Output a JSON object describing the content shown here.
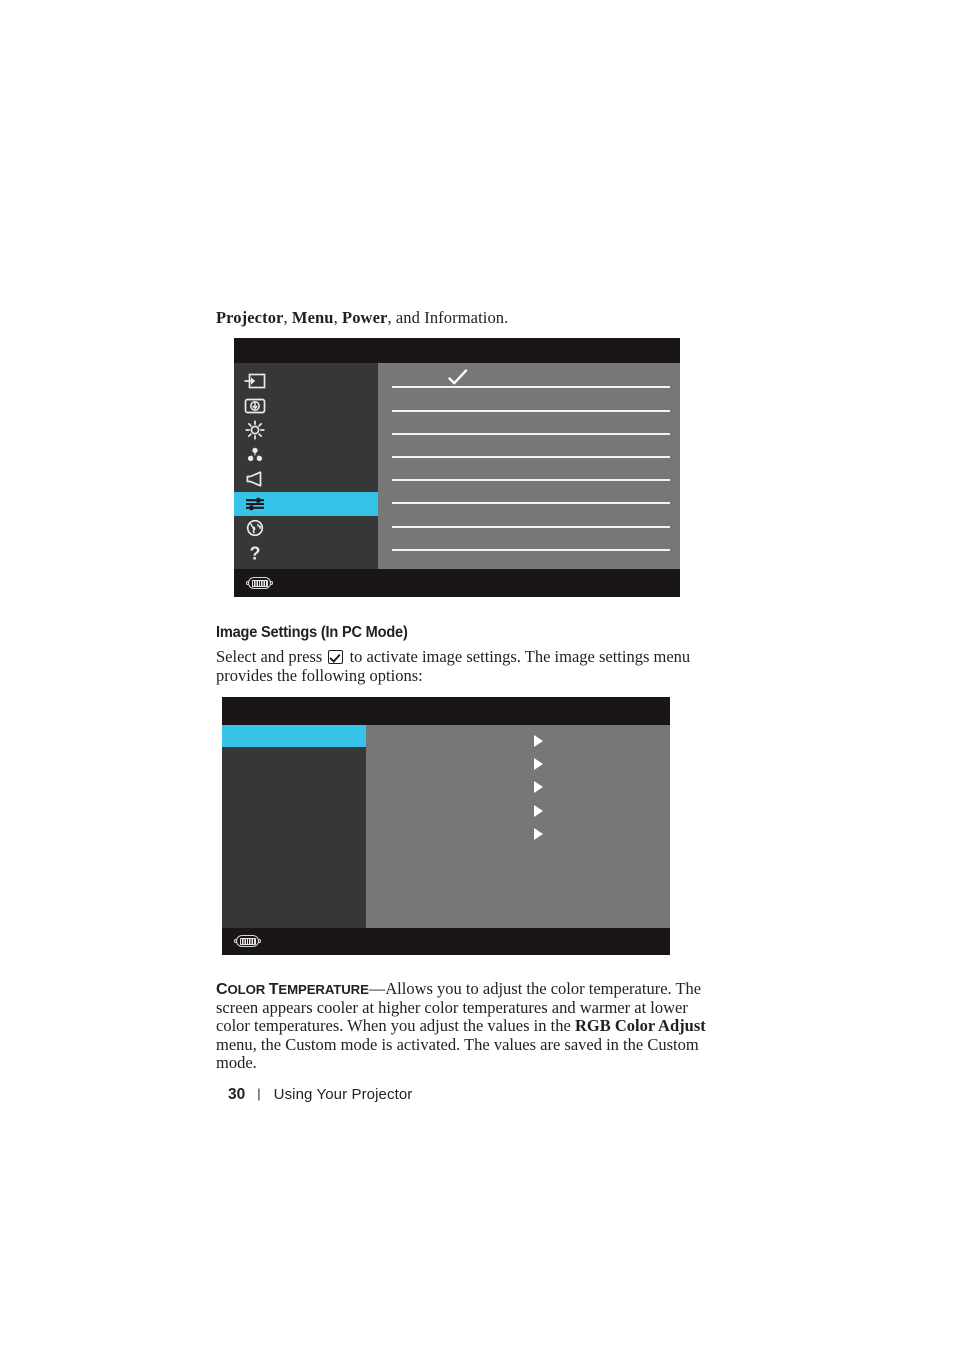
{
  "page": {
    "number": "30",
    "section": "Using Your Projector",
    "separator": "|"
  },
  "intro": {
    "part1": "Projector",
    "comma1": ", ",
    "part2": "Menu",
    "comma2": ", ",
    "part3": "Power",
    "tail": ", and Information."
  },
  "heading": {
    "image_settings": "Image Settings (In PC Mode)"
  },
  "paragraph_1": {
    "before_icon": "Select and press ",
    "icon": "checkbox-check-icon",
    "after_icon": " to activate image settings. The image settings menu provides the following options:"
  },
  "paragraph_2": {
    "term_cap_1": "C",
    "term_rest_1": "OLOR ",
    "term_cap_2": "T",
    "term_rest_2": "EMPERATURE",
    "dash": "—",
    "body_before_bold": "Allows you to adjust the color temperature. The screen appears cooler at higher color temperatures and warmer at lower color temperatures. When you adjust the values in the ",
    "bold_term": "RGB Color Adjust",
    "body_after_bold": " menu, the Custom mode is activated. The values are saved in the Custom mode."
  },
  "osd_main_menu": {
    "caption": "main-osd-menu",
    "colors": {
      "chrome": "#1a1617",
      "sidebar": "#373737",
      "panel": "#777777",
      "highlight": "#35c3e8",
      "line": "#f2f2f2"
    },
    "sidebar_icons": [
      {
        "name": "input-source-icon",
        "selected": false
      },
      {
        "name": "auto-adjust-icon",
        "selected": false
      },
      {
        "name": "brightness-contrast-icon",
        "selected": false
      },
      {
        "name": "color-settings-icon",
        "selected": false
      },
      {
        "name": "volume-speaker-icon",
        "selected": false
      },
      {
        "name": "display-settings-icon",
        "selected": true
      },
      {
        "name": "language-globe-icon",
        "selected": false
      },
      {
        "name": "help-question-icon",
        "selected": false
      }
    ],
    "panel": {
      "selected_marker": "checkmark-icon",
      "separator_count": 8
    },
    "bottom_icon": "vga-connector-icon"
  },
  "osd_image_settings_menu": {
    "caption": "image-settings-osd-menu",
    "colors": {
      "chrome": "#1a1617",
      "sidebar": "#373737",
      "panel": "#777777",
      "highlight": "#35c3e8"
    },
    "sidebar_rows": [
      {
        "name": "menu-row-selected",
        "selected": true
      },
      {
        "name": "menu-row-2",
        "selected": false
      },
      {
        "name": "menu-row-3",
        "selected": false
      },
      {
        "name": "menu-row-4",
        "selected": false
      },
      {
        "name": "menu-row-5",
        "selected": false
      }
    ],
    "submenu_arrows": [
      "submenu-arrow-1",
      "submenu-arrow-2",
      "submenu-arrow-3",
      "submenu-arrow-4",
      "submenu-arrow-5"
    ],
    "bottom_icon": "vga-connector-icon"
  }
}
